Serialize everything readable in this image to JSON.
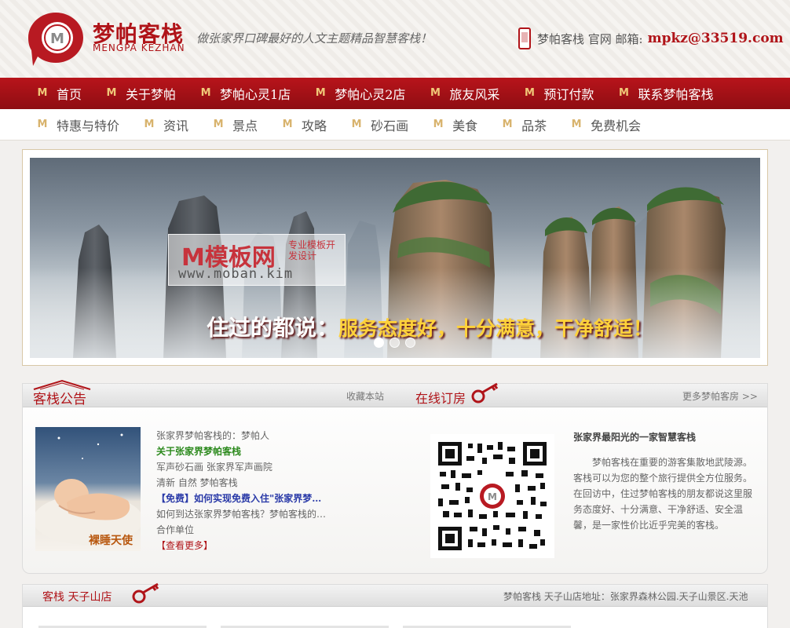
{
  "header": {
    "logo_cn": "梦帕客栈",
    "logo_en": "MENGPA KEZHAN",
    "slogan": "做张家界口碑最好的人文主题精品智慧客栈！",
    "contact_label": "梦帕客栈 官网 邮箱:",
    "email": "mpkz@33519.com"
  },
  "nav_primary": [
    {
      "label": "首页"
    },
    {
      "label": "关于梦帕"
    },
    {
      "label": "梦帕心灵1店"
    },
    {
      "label": "梦帕心灵2店"
    },
    {
      "label": "旅友风采"
    },
    {
      "label": "预订付款"
    },
    {
      "label": "联系梦帕客栈"
    }
  ],
  "nav_secondary": [
    {
      "label": "特惠与特价"
    },
    {
      "label": "资讯"
    },
    {
      "label": "景点"
    },
    {
      "label": "攻略"
    },
    {
      "label": "砂石画"
    },
    {
      "label": "美食"
    },
    {
      "label": "品茶"
    },
    {
      "label": "免费机会"
    }
  ],
  "banner": {
    "caption_lead": "住过的都说：",
    "caption_highlight": "服务态度好，十分满意，干净舒适！",
    "watermark_main": "M模板网",
    "watermark_sub": "专业模板开发设计",
    "watermark_url": "www.moban.kim",
    "slides": 3,
    "active_slide": 1
  },
  "notice": {
    "title": "客栈公告",
    "bookmark": "收藏本站",
    "order_title": "在线订房",
    "more_rooms": "更多梦帕客房 >>",
    "image_caption": "裸睡天使",
    "news": [
      {
        "text": "张家界梦帕客栈的：梦帕人",
        "style": "plain"
      },
      {
        "text": "关于张家界梦帕客栈",
        "style": "green"
      },
      {
        "text": "军声砂石画  张家界军声画院",
        "style": "plain"
      },
      {
        "text": "清新 自然 梦帕客栈",
        "style": "plain"
      },
      {
        "text": "【免费】如何实现免费入住\"张家界梦…",
        "style": "blue"
      },
      {
        "text": "如何到达张家界梦帕客栈？梦帕客栈的…",
        "style": "plain"
      },
      {
        "text": "合作单位",
        "style": "plain"
      },
      {
        "text": "【查看更多】",
        "style": "red"
      }
    ],
    "info_title": "张家界最阳光的一家智慧客栈",
    "info_text": "梦帕客栈在重要的游客集散地武陵源。客栈可以为您的整个旅行提供全方位服务。在回访中，住过梦帕客栈的朋友都说这里服务态度好、十分满意、干净舒适、安全温馨，是一家性价比近乎完美的客栈。"
  },
  "store": {
    "title": "客栈  天子山店",
    "address": "梦帕客栈 天子山店地址：张家界森林公园.天子山景区.天池"
  },
  "colors": {
    "brand_red": "#b01419",
    "accent_gold": "#f0c878"
  }
}
